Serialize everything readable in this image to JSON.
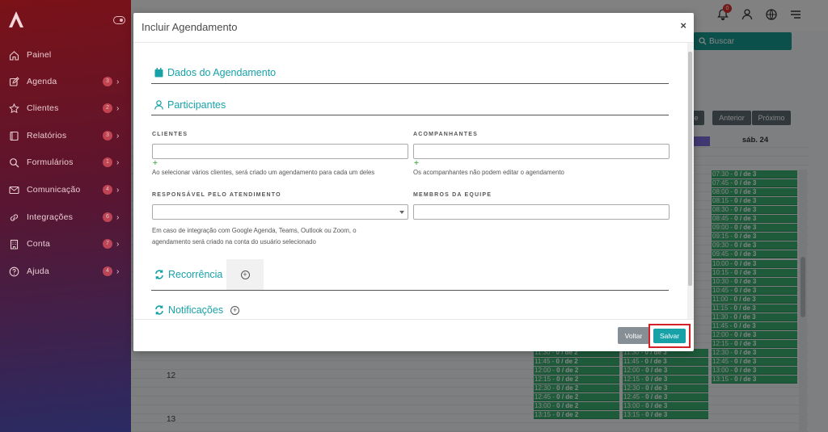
{
  "sidebar": {
    "items": [
      {
        "label": "Painel",
        "icon": "home-icon",
        "badge": "",
        "chevron": ""
      },
      {
        "label": "Agenda",
        "icon": "edit-icon",
        "badge": "3",
        "chevron": "›"
      },
      {
        "label": "Clientes",
        "icon": "star-icon",
        "badge": "2",
        "chevron": "›"
      },
      {
        "label": "Relatórios",
        "icon": "book-icon",
        "badge": "3",
        "chevron": "›"
      },
      {
        "label": "Formulários",
        "icon": "search-icon",
        "badge": "1",
        "chevron": "›"
      },
      {
        "label": "Comunicação",
        "icon": "mail-icon",
        "badge": "4",
        "chevron": "›"
      },
      {
        "label": "Integrações",
        "icon": "link-icon",
        "badge": "6",
        "chevron": "›"
      },
      {
        "label": "Conta",
        "icon": "building-icon",
        "badge": "7",
        "chevron": "›"
      },
      {
        "label": "Ajuda",
        "icon": "help-circle-icon",
        "badge": "4",
        "chevron": "›"
      }
    ]
  },
  "topbar": {
    "notification_count": "0",
    "icons": [
      "bell-icon",
      "user-icon",
      "globe-icon",
      "menu-icon"
    ]
  },
  "background": {
    "search_label": "Buscar",
    "prev_label": "Anterior",
    "next_label": "Próximo",
    "cut_label": "je",
    "day_header": "sáb. 24",
    "hours": [
      "12",
      "13"
    ],
    "slot_suffix": "0 / de 3",
    "col_sat_times": [
      "07:30",
      "07:45",
      "08:00",
      "08:15",
      "08:30",
      "08:45",
      "09:00",
      "09:15",
      "09:30",
      "09:45",
      "10:00",
      "10:15",
      "10:30",
      "10:45",
      "11:00",
      "11:15",
      "11:30",
      "11:45",
      "12:00",
      "12:15",
      "12:30",
      "12:45",
      "13:00",
      "13:15"
    ],
    "col_left_times": [
      "11:30",
      "11:45",
      "12:00",
      "12:15",
      "12:30",
      "12:45",
      "13:00",
      "13:15"
    ],
    "col_left_suffix": "0 / de 2"
  },
  "modal": {
    "title": "Incluir Agendamento",
    "close": "×",
    "sections": {
      "dados": "Dados do Agendamento",
      "participantes": "Participantes",
      "recorrencia": "Recorrência",
      "notificacoes": "Notificações"
    },
    "fields": {
      "clientes_label": "CLIENTES",
      "clientes_value": "",
      "clientes_help": "Ao selecionar vários clientes, será criado um agendamento para cada um deles",
      "acompanhantes_label": "ACOMPANHANTES",
      "acompanhantes_value": "",
      "acompanhantes_help": "Os acompanhantes não podem editar o agendamento",
      "responsavel_label": "RESPONSÁVEL PELO ATENDIMENTO",
      "responsavel_value": "",
      "responsavel_help_1": "Em caso de integração com Google Agenda, Teams, Outlook ou Zoom, o",
      "responsavel_help_2": "agendamento será criado na conta do usuário selecionado",
      "membros_label": "MEMBROS DA EQUIPE",
      "membros_value": "",
      "plus": "+"
    },
    "buttons": {
      "voltar": "Voltar",
      "salvar": "Salvar"
    }
  },
  "colors": {
    "accent": "#17a2a8",
    "slot_green": "#3bae72",
    "highlight": "#d42026",
    "sidebar_top": "#7a1218",
    "sidebar_bottom": "#2a2b63"
  }
}
